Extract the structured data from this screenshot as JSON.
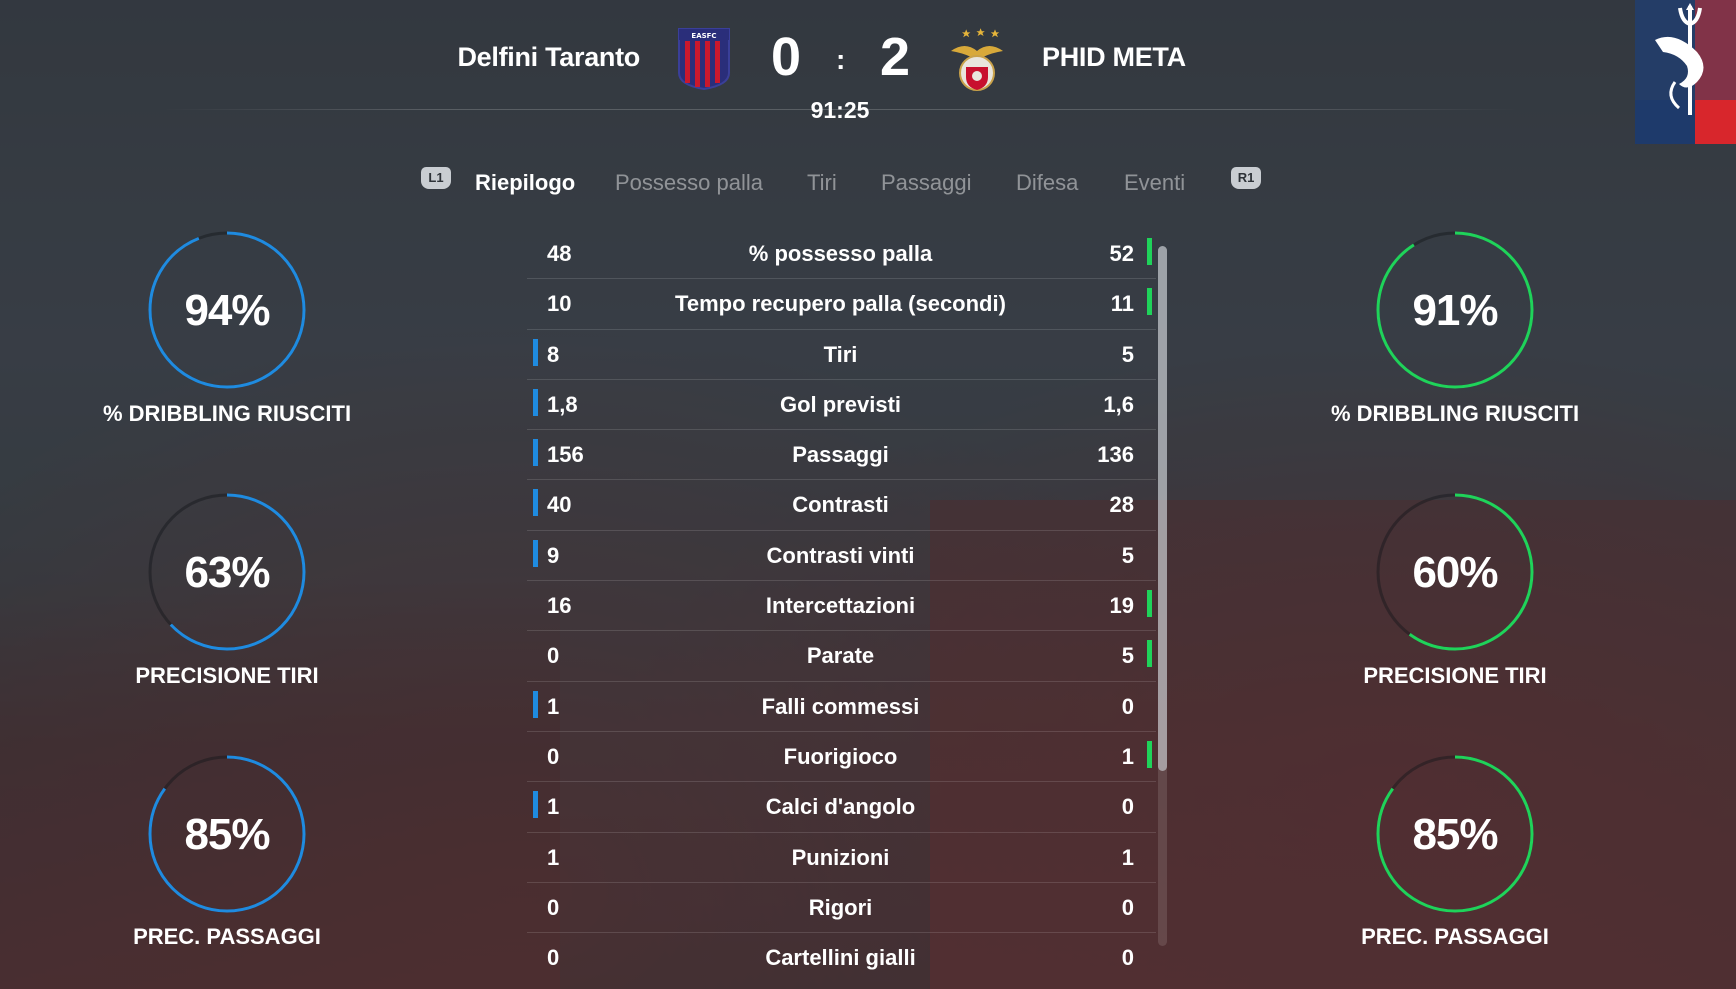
{
  "match": {
    "home_team": "Delfini Taranto",
    "away_team": "PHID META",
    "home_score": "0",
    "away_score": "2",
    "separator": ":",
    "clock": "91:25",
    "home_crest_text": "EASFC"
  },
  "tabs": {
    "left_bumper": "L1",
    "right_bumper": "R1",
    "items": [
      "Riepilogo",
      "Possesso palla",
      "Tiri",
      "Passaggi",
      "Difesa",
      "Eventi"
    ],
    "active": "Riepilogo"
  },
  "colors": {
    "home": "#1f8be0",
    "away": "#1fd35a"
  },
  "gauges": {
    "home": [
      {
        "value": "94%",
        "percent": 94,
        "label": "% DRIBBLING RIUSCITI"
      },
      {
        "value": "63%",
        "percent": 63,
        "label": "PRECISIONE TIRI"
      },
      {
        "value": "85%",
        "percent": 85,
        "label": "PREC. PASSAGGI"
      }
    ],
    "away": [
      {
        "value": "91%",
        "percent": 91,
        "label": "% DRIBBLING RIUSCITI"
      },
      {
        "value": "60%",
        "percent": 60,
        "label": "PRECISIONE TIRI"
      },
      {
        "value": "85%",
        "percent": 85,
        "label": "PREC. PASSAGGI"
      }
    ]
  },
  "stats": [
    {
      "label": "% possesso palla",
      "home": "48",
      "away": "52",
      "leader": "away"
    },
    {
      "label": "Tempo recupero palla (secondi)",
      "home": "10",
      "away": "11",
      "leader": "away"
    },
    {
      "label": "Tiri",
      "home": "8",
      "away": "5",
      "leader": "home"
    },
    {
      "label": "Gol previsti",
      "home": "1,8",
      "away": "1,6",
      "leader": "home"
    },
    {
      "label": "Passaggi",
      "home": "156",
      "away": "136",
      "leader": "home"
    },
    {
      "label": "Contrasti",
      "home": "40",
      "away": "28",
      "leader": "home"
    },
    {
      "label": "Contrasti vinti",
      "home": "9",
      "away": "5",
      "leader": "home"
    },
    {
      "label": "Intercettazioni",
      "home": "16",
      "away": "19",
      "leader": "away"
    },
    {
      "label": "Parate",
      "home": "0",
      "away": "5",
      "leader": "away"
    },
    {
      "label": "Falli commessi",
      "home": "1",
      "away": "0",
      "leader": "home"
    },
    {
      "label": "Fuorigioco",
      "home": "0",
      "away": "1",
      "leader": "away"
    },
    {
      "label": "Calci d'angolo",
      "home": "1",
      "away": "0",
      "leader": "home"
    },
    {
      "label": "Punizioni",
      "home": "1",
      "away": "1",
      "leader": "none"
    },
    {
      "label": "Rigori",
      "home": "0",
      "away": "0",
      "leader": "none"
    },
    {
      "label": "Cartellini gialli",
      "home": "0",
      "away": "0",
      "leader": "none"
    }
  ]
}
